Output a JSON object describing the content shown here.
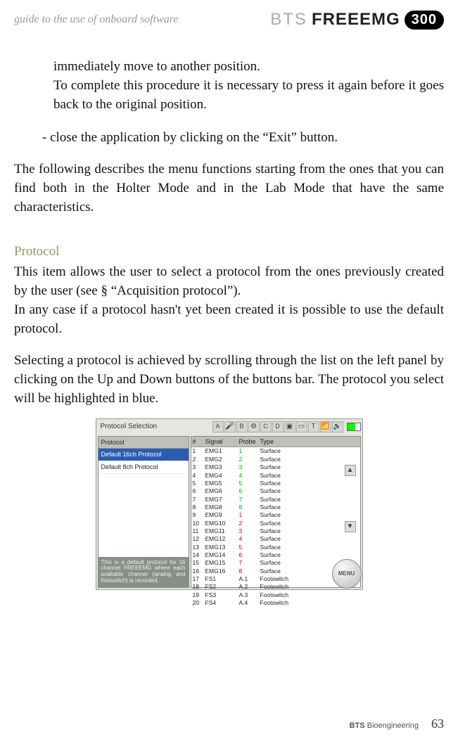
{
  "header": {
    "guide": "guide to the use of onboard software",
    "logo_bts": "BTS",
    "logo_freeemg": "FREEEMG",
    "badge": "300"
  },
  "body": {
    "p1a": "immediately move to another position.",
    "p1b": "To complete this procedure it is necessary to press it again before it goes back to the original position.",
    "p2": "- close the application by clicking on the “Exit” button.",
    "p3": "The following describes the menu functions starting from the ones that you can find both in the Holter Mode and in the Lab Mode that have the same characteristics.",
    "sect": "Protocol",
    "p4": "This item allows the user to select a protocol from the ones previously created by the user  (see § “Acquisition protocol”).",
    "p5": "In any case if a protocol hasn't yet been created it is possible to use the default protocol.",
    "p6": "Selecting a protocol is achieved by  scrolling through the list on the left panel by clicking on the Up and Down buttons of the buttons bar. The protocol you select will be highlighted in blue."
  },
  "shot": {
    "title": "Protocol Selection",
    "tabs": [
      "A",
      "B",
      "C",
      "D"
    ],
    "left_header": "Protocol",
    "protocols": [
      "Default 16ch Protocol",
      "Default 8ch Protocol"
    ],
    "desc": "This is a default protocol for 16 channel FREEEMG where each available channel (analog and footswitch) is recorded.",
    "headers": {
      "num": "#",
      "sig": "Signal",
      "probe": "Probe",
      "type": "Type"
    },
    "menu": "MENU"
  },
  "chart_data": {
    "type": "table",
    "title": "Protocol Selection — channel list",
    "columns": [
      "#",
      "Signal",
      "Probe",
      "Type"
    ],
    "rows": [
      {
        "n": 1,
        "sig": "EMG1",
        "probe": "1",
        "type": "Surface",
        "pc": "g"
      },
      {
        "n": 2,
        "sig": "EMG2",
        "probe": "2",
        "type": "Surface",
        "pc": "g"
      },
      {
        "n": 3,
        "sig": "EMG3",
        "probe": "3",
        "type": "Surface",
        "pc": "g"
      },
      {
        "n": 4,
        "sig": "EMG4",
        "probe": "4",
        "type": "Surface",
        "pc": "g"
      },
      {
        "n": 5,
        "sig": "EMG5",
        "probe": "5",
        "type": "Surface",
        "pc": "g"
      },
      {
        "n": 6,
        "sig": "EMG6",
        "probe": "6",
        "type": "Surface",
        "pc": "g"
      },
      {
        "n": 7,
        "sig": "EMG7",
        "probe": "7",
        "type": "Surface",
        "pc": "g"
      },
      {
        "n": 8,
        "sig": "EMG8",
        "probe": "8",
        "type": "Surface",
        "pc": "g"
      },
      {
        "n": 9,
        "sig": "EMG9",
        "probe": "1",
        "type": "Surface",
        "pc": "r"
      },
      {
        "n": 10,
        "sig": "EMG10",
        "probe": "2",
        "type": "Surface",
        "pc": "r"
      },
      {
        "n": 11,
        "sig": "EMG11",
        "probe": "3",
        "type": "Surface",
        "pc": "r"
      },
      {
        "n": 12,
        "sig": "EMG12",
        "probe": "4",
        "type": "Surface",
        "pc": "r"
      },
      {
        "n": 13,
        "sig": "EMG13",
        "probe": "5",
        "type": "Surface",
        "pc": "r"
      },
      {
        "n": 14,
        "sig": "EMG14",
        "probe": "6",
        "type": "Surface",
        "pc": "r"
      },
      {
        "n": 15,
        "sig": "EMG15",
        "probe": "7",
        "type": "Surface",
        "pc": "r"
      },
      {
        "n": 16,
        "sig": "EMG16",
        "probe": "8",
        "type": "Surface",
        "pc": "r"
      },
      {
        "n": 17,
        "sig": "FS1",
        "probe": "A.1",
        "type": "Footswitch",
        "pc": ""
      },
      {
        "n": 18,
        "sig": "FS2",
        "probe": "A.2",
        "type": "Footswitch",
        "pc": ""
      },
      {
        "n": 19,
        "sig": "FS3",
        "probe": "A.3",
        "type": "Footswitch",
        "pc": ""
      },
      {
        "n": 20,
        "sig": "FS4",
        "probe": "A.4",
        "type": "Footswitch",
        "pc": ""
      }
    ]
  },
  "footer": {
    "brand_bold": "BTS",
    "brand_rest": " Bioengineering",
    "page": "63"
  }
}
